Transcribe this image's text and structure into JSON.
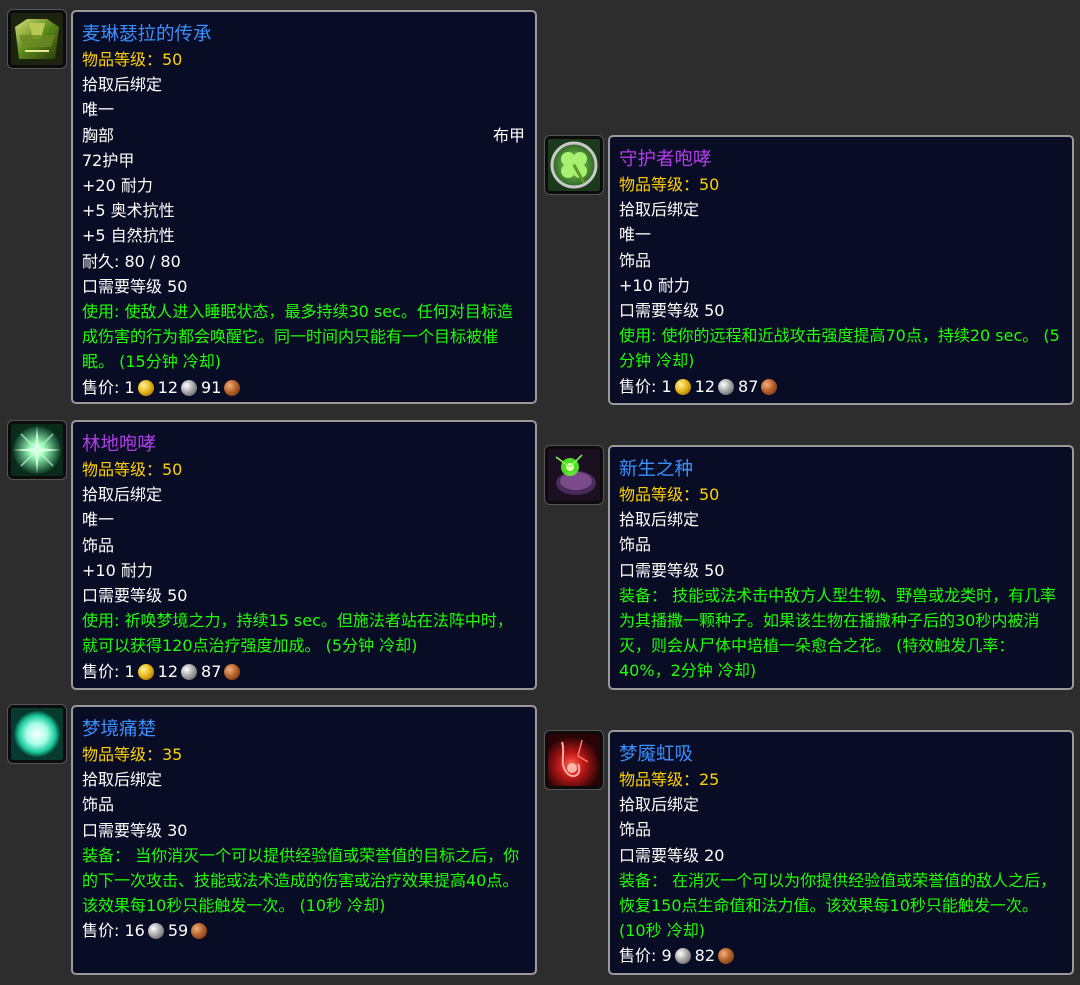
{
  "items": [
    {
      "name": "麦琳瑟拉的传承",
      "item_level": "物品等级：50",
      "bind": "拾取后绑定",
      "unique": "唯一",
      "slot": "胸部",
      "armor_type": "布甲",
      "armor": "72护甲",
      "stats": [
        "+20 耐力",
        "+5 奥术抗性",
        "+5 自然抗性"
      ],
      "durability": "耐久: 80 / 80",
      "requires": "口需要等级 50",
      "effect": "使用: 使敌人进入睡眠状态，最多持续30 sec。任何对目标造成伤害的行为都会唤醒它。同一时间内只能有一个目标被催眠。 (15分钟 冷却)",
      "sell_label": "售价: ",
      "gold": "1",
      "silver": "12",
      "copper": "91",
      "icon": "chest-armor-icon"
    },
    {
      "name": "守护者咆哮",
      "item_level": "物品等级：50",
      "bind": "拾取后绑定",
      "unique": "唯一",
      "slot": "饰品",
      "stats": [
        "+10 耐力"
      ],
      "requires": "口需要等级 50",
      "effect": "使用: 使你的远程和近战攻击强度提高70点，持续20 sec。 (5分钟 冷却)",
      "sell_label": "售价: ",
      "gold": "1",
      "silver": "12",
      "copper": "87",
      "icon": "clover-icon"
    },
    {
      "name": "林地咆哮",
      "item_level": "物品等级：50",
      "bind": "拾取后绑定",
      "unique": "唯一",
      "slot": "饰品",
      "stats": [
        "+10 耐力"
      ],
      "requires": "口需要等级 50",
      "effect": "使用: 祈唤梦境之力，持续15 sec。但施法者站在法阵中时，就可以获得120点治疗强度加成。 (5分钟 冷却)",
      "sell_label": "售价: ",
      "gold": "1",
      "silver": "12",
      "copper": "87",
      "icon": "green-starburst-icon"
    },
    {
      "name": "新生之种",
      "item_level": "物品等级：50",
      "bind": "拾取后绑定",
      "slot": "饰品",
      "requires": "口需要等级 50",
      "effect": "装备： 技能或法术击中敌方人型生物、野兽或龙类时，有几率为其播撒一颗种子。如果该生物在播撒种子后的30秒内被消灭，则会从尸体中培植一朵愈合之花。 (特效触发几率：40%，2分钟 冷却)",
      "icon": "seed-pod-icon"
    },
    {
      "name": "梦境痛楚",
      "item_level": "物品等级：35",
      "bind": "拾取后绑定",
      "slot": "饰品",
      "requires": "口需要等级 30",
      "effect": "装备： 当你消灭一个可以提供经验值或荣誉值的目标之后，你的下一次攻击、技能或法术造成的伤害或治疗效果提高40点。该效果每10秒只能触发一次。 (10秒 冷却)",
      "sell_label": "售价: ",
      "silver": "16",
      "copper": "59",
      "icon": "glowing-orb-icon"
    },
    {
      "name": "梦魇虹吸",
      "item_level": "物品等级：25",
      "bind": "拾取后绑定",
      "slot": "饰品",
      "requires": "口需要等级 20",
      "effect": "装备： 在消灭一个可以为你提供经验值或荣誉值的敌人之后，恢复150点生命值和法力值。该效果每10秒只能触发一次。 (10秒 冷却)",
      "sell_label": "售价: ",
      "silver": "9",
      "copper": "82",
      "icon": "red-siphon-icon"
    }
  ],
  "colors": {
    "tooltip_bg": "#080c24",
    "border": "#9a9a9a",
    "rare_blue": "#3b8fff",
    "epic_purple": "#b13ee8",
    "item_level_yellow": "#ffd100",
    "effect_green": "#1eff00"
  }
}
